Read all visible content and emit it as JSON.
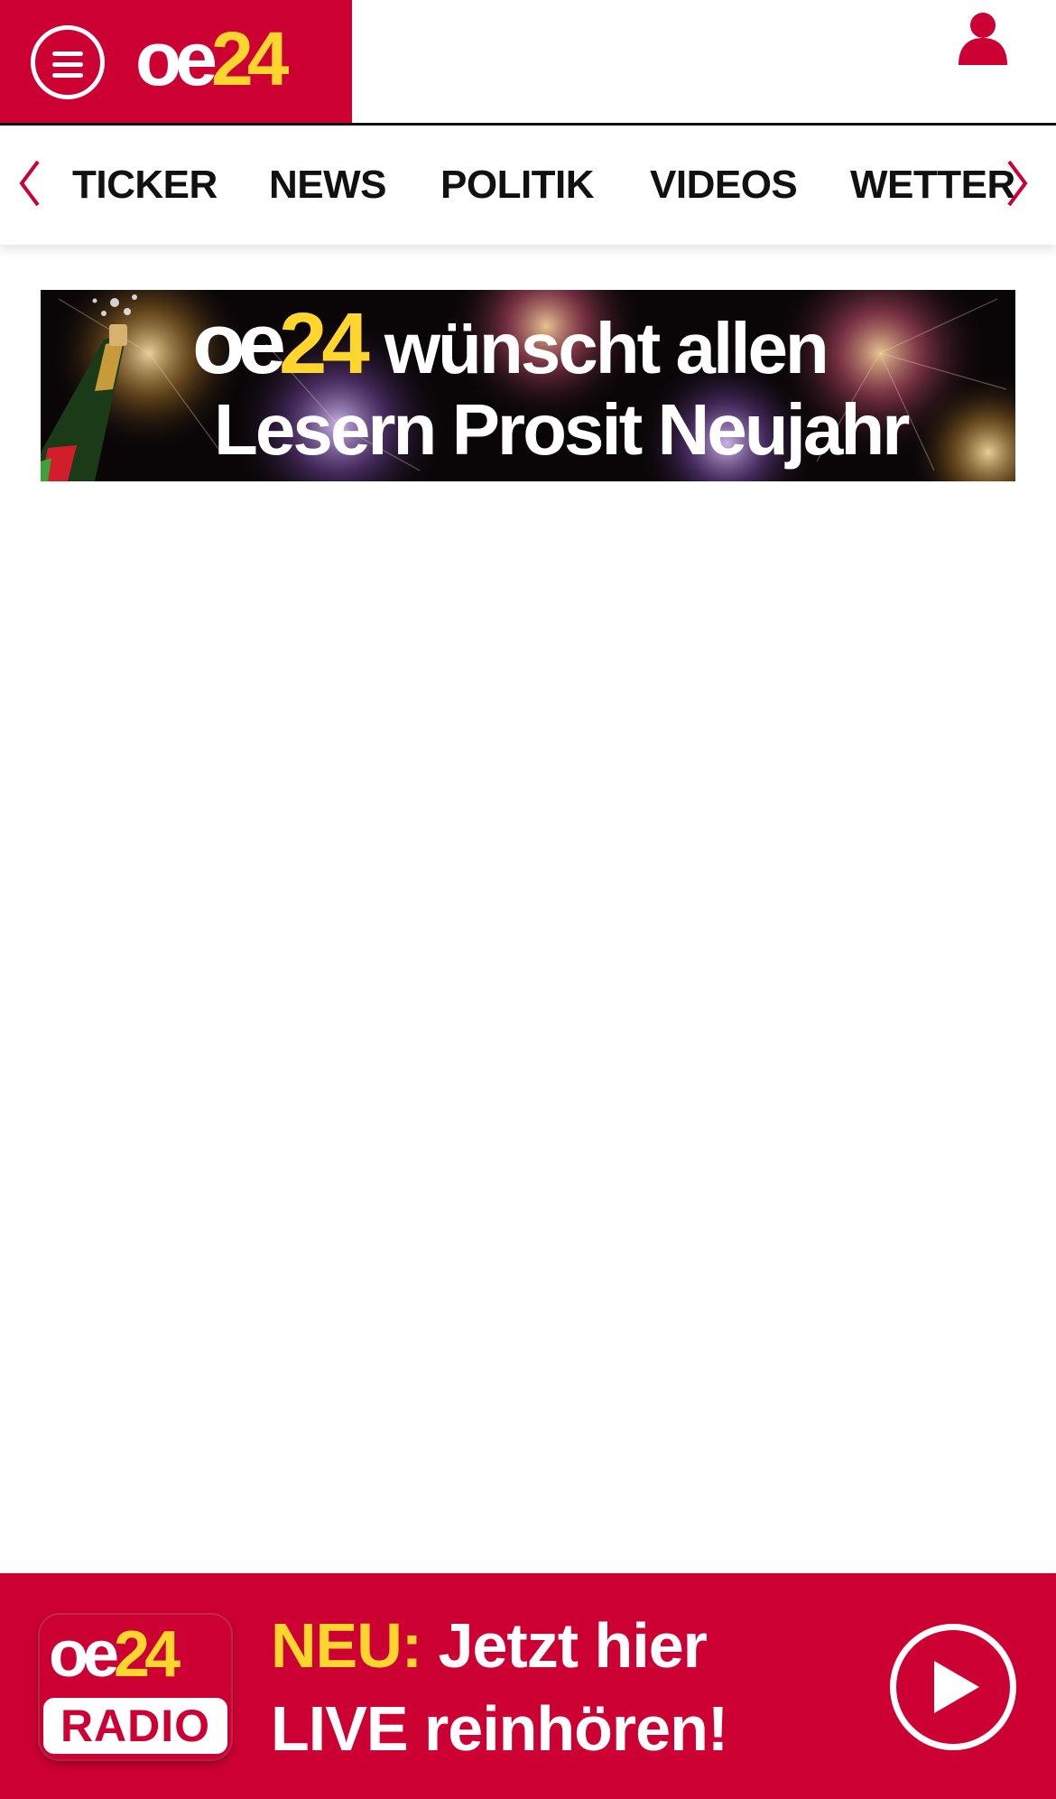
{
  "colors": {
    "brand_red": "#cc0033",
    "brand_yellow": "#ffd52e",
    "text_dark": "#111111",
    "white": "#ffffff"
  },
  "header": {
    "logo": {
      "part1": "oe",
      "part2": "24"
    },
    "menu_icon": "hamburger-menu-icon",
    "user_icon": "user-icon"
  },
  "nav": {
    "prev_icon": "chevron-left-icon",
    "next_icon": "chevron-right-icon",
    "items": [
      {
        "label": "TICKER"
      },
      {
        "label": "NEWS"
      },
      {
        "label": "POLITIK"
      },
      {
        "label": "VIDEOS"
      },
      {
        "label": "WETTER"
      }
    ]
  },
  "banner": {
    "logo_part1": "oe",
    "logo_part2": "24",
    "line1": "wünscht allen",
    "line2": "Lesern Prosit Neujahr"
  },
  "radio": {
    "logo_part1": "oe",
    "logo_part2": "24",
    "logo_label": "RADIO",
    "accent": "NEU:",
    "line1_rest": " Jetzt hier",
    "line2": "LIVE reinhören!",
    "play_icon": "play-icon"
  }
}
